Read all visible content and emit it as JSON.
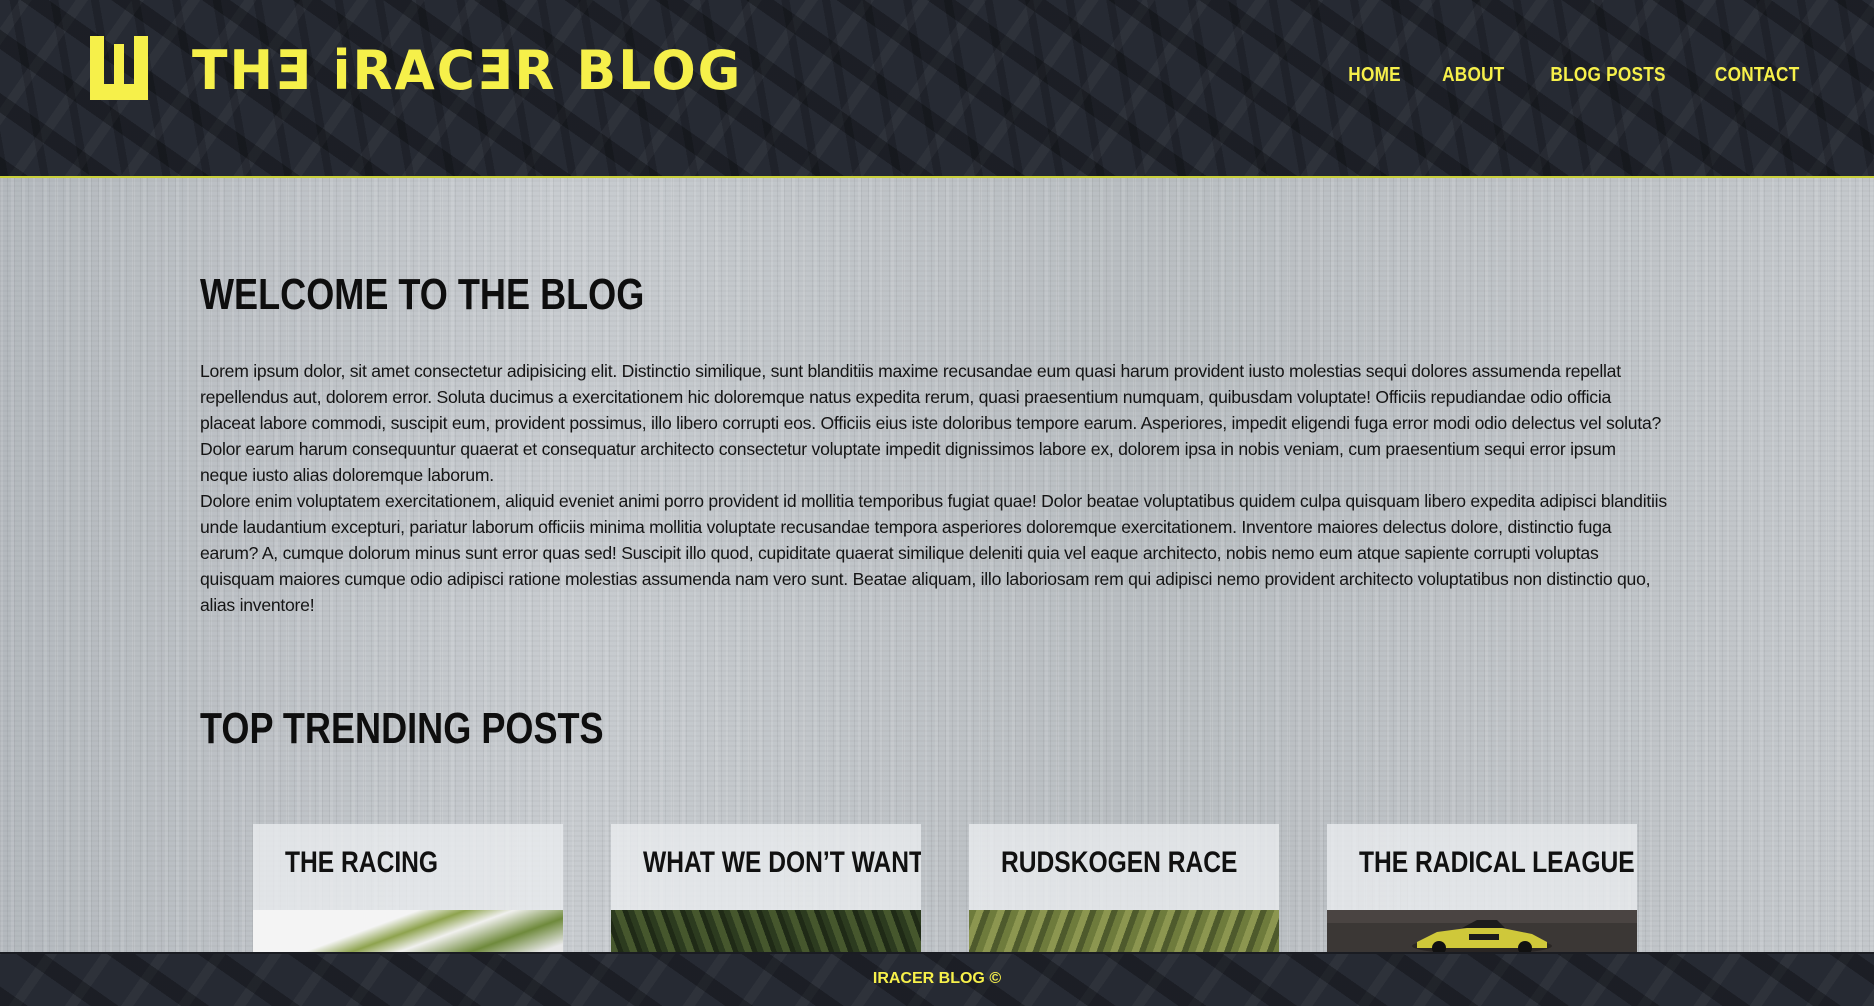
{
  "brand": {
    "logo_icon": "w-block-logo-icon",
    "title": "THƎ iRACƎR BLOG",
    "accent_color": "#f6f04a"
  },
  "nav": {
    "items": [
      {
        "label": "HOME"
      },
      {
        "label": "ABOUT"
      },
      {
        "label": "BLOG POSTS"
      },
      {
        "label": "CONTACT"
      }
    ]
  },
  "main": {
    "welcome_heading": "WELCOME TO THE BLOG",
    "paragraphs": [
      "Lorem ipsum dolor, sit amet consectetur adipisicing elit. Distinctio similique, sunt blanditiis maxime recusandae eum quasi harum provident iusto molestias sequi dolores assumenda repellat repellendus aut, dolorem error. Soluta ducimus a exercitationem hic doloremque natus expedita rerum, quasi praesentium numquam, quibusdam voluptate! Officiis repudiandae odio officia placeat labore commodi, suscipit eum, provident possimus, illo libero corrupti eos. Officiis eius iste doloribus tempore earum. Asperiores, impedit eligendi fuga error modi odio delectus vel soluta? Dolor earum harum consequuntur quaerat et consequatur architecto consectetur voluptate impedit dignissimos labore ex, dolorem ipsa in nobis veniam, cum praesentium sequi error ipsum neque iusto alias doloremque laborum.",
      "Dolore enim voluptatem exercitationem, aliquid eveniet animi porro provident id mollitia temporibus fugiat quae! Dolor beatae voluptatibus quidem culpa quisquam libero expedita adipisci blanditiis unde laudantium excepturi, pariatur laborum officiis minima mollitia voluptate recusandae tempora asperiores doloremque exercitationem. Inventore maiores delectus dolore, distinctio fuga earum? A, cumque dolorum minus sunt error quas sed! Suscipit illo quod, cupiditate quaerat similique deleniti quia vel eaque architecto, nobis nemo eum atque sapiente corrupti voluptas quisquam maiores cumque odio adipisci ratione molestias assumenda nam vero sunt. Beatae aliquam, illo laboriosam rem qui adipisci nemo provident architecto voluptatibus non distinctio quo, alias inventore!"
    ],
    "trending_heading": "TOP TRENDING POSTS",
    "posts": [
      {
        "title": "THE RACING"
      },
      {
        "title": "WHAT WE DON’T WANT"
      },
      {
        "title": "RUDSKOGEN RACE"
      },
      {
        "title": "THE RADICAL LEAGUE"
      }
    ]
  },
  "footer": {
    "text": "IRACER BLOG ©"
  }
}
